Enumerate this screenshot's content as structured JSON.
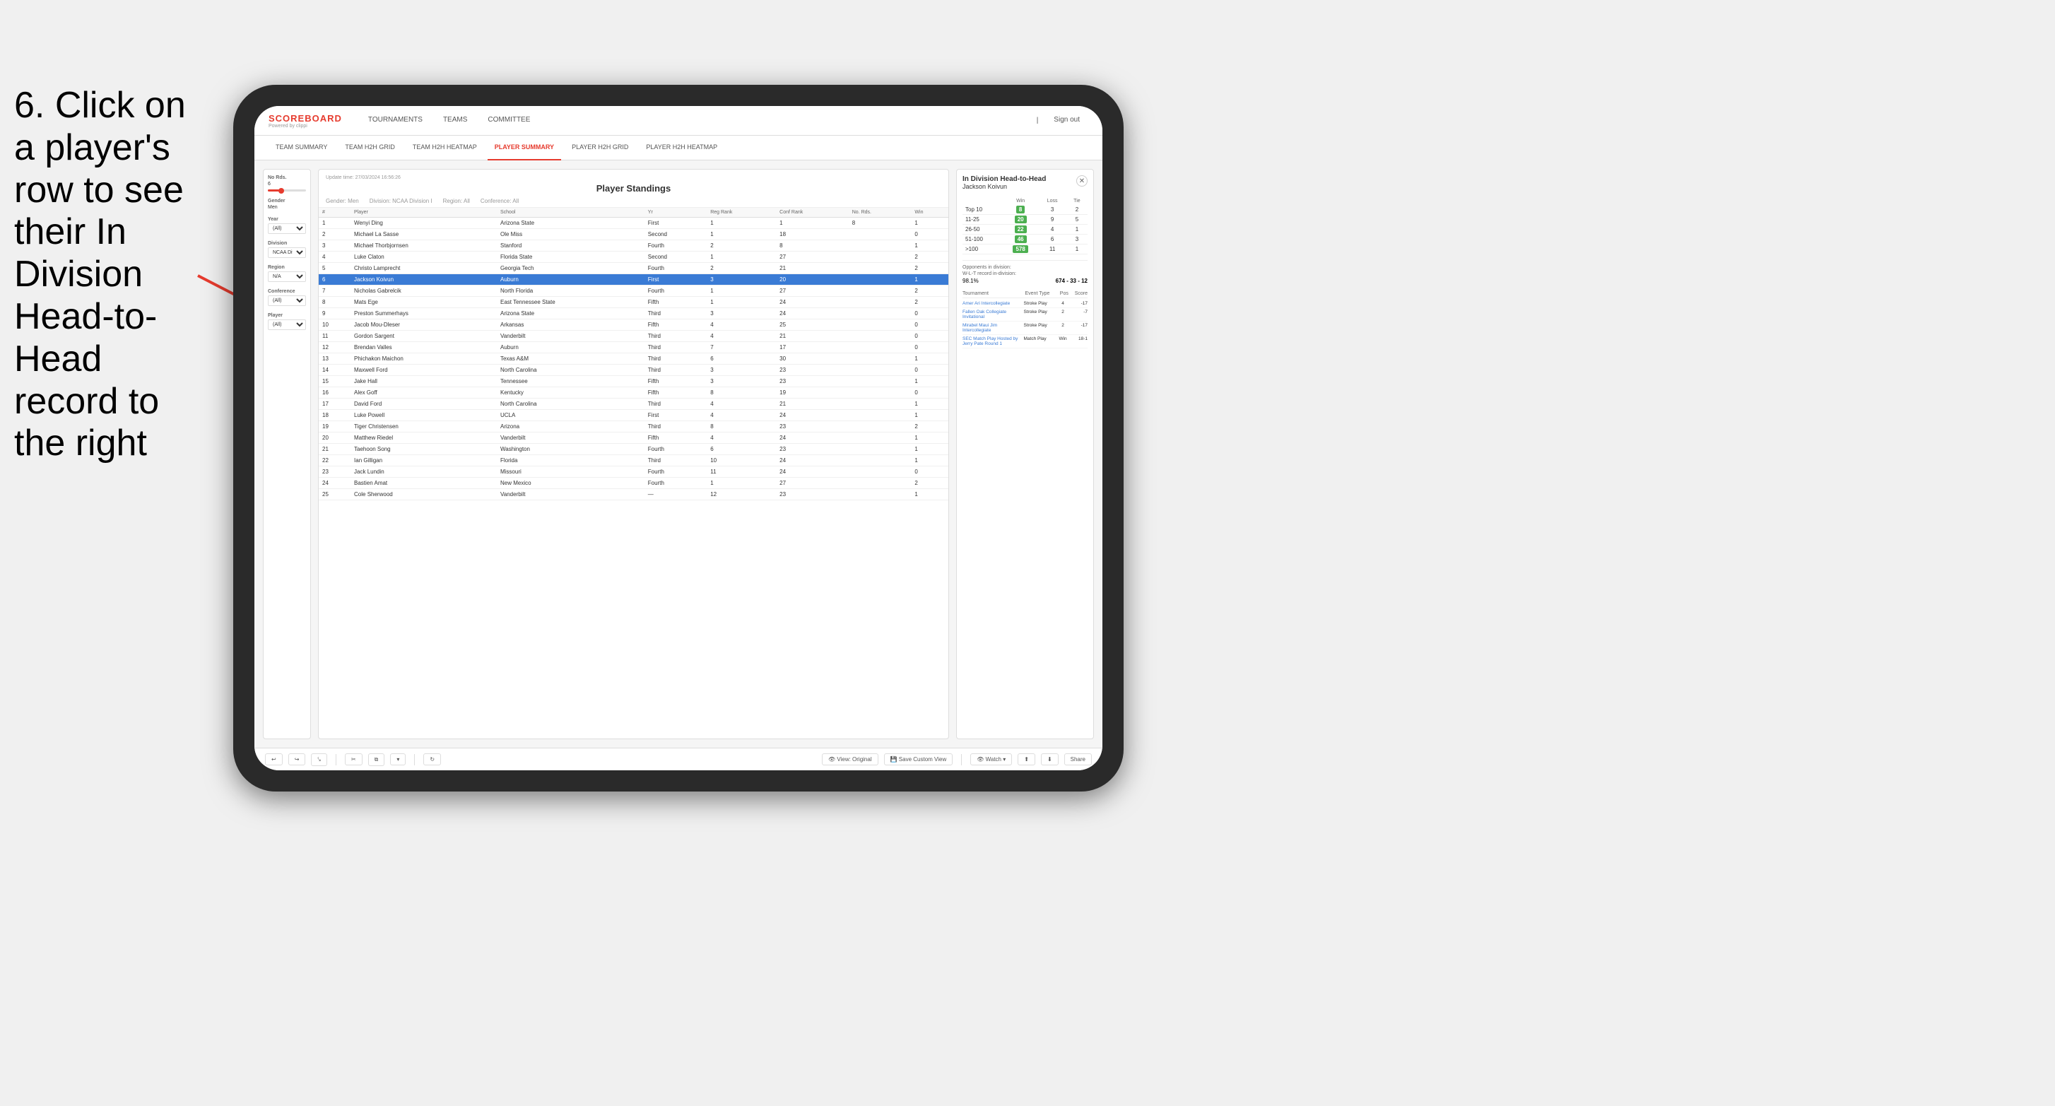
{
  "instruction": {
    "text": "6. Click on a player's row to see their In Division Head-to-Head record to the right"
  },
  "nav": {
    "logo_main": "SCOREBOARD",
    "logo_sub": "Powered by clippi",
    "items": [
      "TOURNAMENTS",
      "TEAMS",
      "COMMITTEE"
    ],
    "sign_out": "Sign out"
  },
  "sub_nav": {
    "items": [
      "TEAM SUMMARY",
      "TEAM H2H GRID",
      "TEAM H2H HEATMAP",
      "PLAYER SUMMARY",
      "PLAYER H2H GRID",
      "PLAYER H2H HEATMAP"
    ],
    "active": "PLAYER SUMMARY"
  },
  "filters": {
    "no_rds_label": "No Rds.",
    "no_rds_value": "6",
    "gender_label": "Gender",
    "gender_value": "Men",
    "year_label": "Year",
    "year_value": "(All)",
    "division_label": "Division",
    "division_value": "NCAA Division I",
    "region_label": "Region",
    "region_value": "N/A",
    "conference_label": "Conference",
    "conference_value": "(All)",
    "player_label": "Player",
    "player_value": "(All)"
  },
  "standings": {
    "update_time": "Update time: 27/03/2024 16:56:26",
    "title": "Player Standings",
    "gender_filter": "Gender: Men",
    "division_filter": "Division: NCAA Division I",
    "region_filter": "Region: All",
    "conference_filter": "Conference: All",
    "columns": [
      "#",
      "Player",
      "School",
      "Yr",
      "Reg Rank",
      "Conf Rank",
      "No. Rds.",
      "Win"
    ],
    "rows": [
      {
        "num": 1,
        "player": "Wenyi Ding",
        "school": "Arizona State",
        "year": "First",
        "reg_rank": 1,
        "conf_rank": 1,
        "no_rds": 8,
        "win": 1
      },
      {
        "num": 2,
        "player": "Michael La Sasse",
        "school": "Ole Miss",
        "year": "Second",
        "reg_rank": 1,
        "conf_rank": 18,
        "win": 0
      },
      {
        "num": 3,
        "player": "Michael Thorbjornsen",
        "school": "Stanford",
        "year": "Fourth",
        "reg_rank": 2,
        "conf_rank": 8,
        "win": 1
      },
      {
        "num": 4,
        "player": "Luke Claton",
        "school": "Florida State",
        "year": "Second",
        "reg_rank": 1,
        "conf_rank": 27,
        "win": 2
      },
      {
        "num": 5,
        "player": "Christo Lamprecht",
        "school": "Georgia Tech",
        "year": "Fourth",
        "reg_rank": 2,
        "conf_rank": 21,
        "win": 2
      },
      {
        "num": 6,
        "player": "Jackson Koivun",
        "school": "Auburn",
        "year": "First",
        "reg_rank": 3,
        "conf_rank": 20,
        "win": 1,
        "selected": true
      },
      {
        "num": 7,
        "player": "Nicholas Gabrelcik",
        "school": "North Florida",
        "year": "Fourth",
        "reg_rank": 1,
        "conf_rank": 27,
        "win": 2
      },
      {
        "num": 8,
        "player": "Mats Ege",
        "school": "East Tennessee State",
        "year": "Fifth",
        "reg_rank": 1,
        "conf_rank": 24,
        "win": 2
      },
      {
        "num": 9,
        "player": "Preston Summerhays",
        "school": "Arizona State",
        "year": "Third",
        "reg_rank": 3,
        "conf_rank": 24,
        "win": 0
      },
      {
        "num": 10,
        "player": "Jacob Mou-Dleser",
        "school": "Arkansas",
        "year": "Fifth",
        "reg_rank": 4,
        "conf_rank": 25,
        "win": 0
      },
      {
        "num": 11,
        "player": "Gordon Sargent",
        "school": "Vanderbilt",
        "year": "Third",
        "reg_rank": 4,
        "conf_rank": 21,
        "win": 0
      },
      {
        "num": 12,
        "player": "Brendan Valles",
        "school": "Auburn",
        "year": "Third",
        "reg_rank": 7,
        "conf_rank": 17,
        "win": 0
      },
      {
        "num": 13,
        "player": "Phichakon Maichon",
        "school": "Texas A&M",
        "year": "Third",
        "reg_rank": 6,
        "conf_rank": 30,
        "win": 1
      },
      {
        "num": 14,
        "player": "Maxwell Ford",
        "school": "North Carolina",
        "year": "Third",
        "reg_rank": 3,
        "conf_rank": 23,
        "win": 0
      },
      {
        "num": 15,
        "player": "Jake Hall",
        "school": "Tennessee",
        "year": "Fifth",
        "reg_rank": 3,
        "conf_rank": 23,
        "win": 1
      },
      {
        "num": 16,
        "player": "Alex Goff",
        "school": "Kentucky",
        "year": "Fifth",
        "reg_rank": 8,
        "conf_rank": 19,
        "win": 0
      },
      {
        "num": 17,
        "player": "David Ford",
        "school": "North Carolina",
        "year": "Third",
        "reg_rank": 4,
        "conf_rank": 21,
        "win": 1
      },
      {
        "num": 18,
        "player": "Luke Powell",
        "school": "UCLA",
        "year": "First",
        "reg_rank": 4,
        "conf_rank": 24,
        "win": 1
      },
      {
        "num": 19,
        "player": "Tiger Christensen",
        "school": "Arizona",
        "year": "Third",
        "reg_rank": 8,
        "conf_rank": 23,
        "win": 2
      },
      {
        "num": 20,
        "player": "Matthew Riedel",
        "school": "Vanderbilt",
        "year": "Fifth",
        "reg_rank": 4,
        "conf_rank": 24,
        "win": 1
      },
      {
        "num": 21,
        "player": "Taehoon Song",
        "school": "Washington",
        "year": "Fourth",
        "reg_rank": 6,
        "conf_rank": 23,
        "win": 1
      },
      {
        "num": 22,
        "player": "Ian Gilligan",
        "school": "Florida",
        "year": "Third",
        "reg_rank": 10,
        "conf_rank": 24,
        "win": 1
      },
      {
        "num": 23,
        "player": "Jack Lundin",
        "school": "Missouri",
        "year": "Fourth",
        "reg_rank": 11,
        "conf_rank": 24,
        "win": 0
      },
      {
        "num": 24,
        "player": "Bastien Amat",
        "school": "New Mexico",
        "year": "Fourth",
        "reg_rank": 1,
        "conf_rank": 27,
        "win": 2
      },
      {
        "num": 25,
        "player": "Cole Sherwood",
        "school": "Vanderbilt",
        "year": "—",
        "reg_rank": 12,
        "conf_rank": 23,
        "win": 1
      }
    ]
  },
  "h2h": {
    "title": "In Division Head-to-Head",
    "player": "Jackson Koivun",
    "table_headers": [
      "",
      "Win",
      "Loss",
      "Tie"
    ],
    "rows": [
      {
        "range": "Top 10",
        "win": 8,
        "loss": 3,
        "tie": 2
      },
      {
        "range": "11-25",
        "win": 20,
        "loss": 9,
        "tie": 5
      },
      {
        "range": "26-50",
        "win": 22,
        "loss": 4,
        "tie": 1
      },
      {
        "range": "51-100",
        "win": 46,
        "loss": 6,
        "tie": 3
      },
      {
        "range": ">100",
        "win": 578,
        "loss": 11,
        "tie": 1
      }
    ],
    "opponents_label": "Opponents in division:",
    "record_label": "W-L-T record in-division:",
    "opponents_pct": "98.1%",
    "record": "674 - 33 - 12",
    "tournament_columns": [
      "Tournament",
      "Event Type",
      "Pos",
      "Score"
    ],
    "tournaments": [
      {
        "name": "Amer Ari Intercollegiate",
        "type": "Stroke Play",
        "pos": 4,
        "score": "-17"
      },
      {
        "name": "Fallen Oak Collegiate Invitational",
        "type": "Stroke Play",
        "pos": 2,
        "score": "-7"
      },
      {
        "name": "Mirabel Maui Jim Intercollegiate",
        "type": "Stroke Play",
        "pos": 2,
        "score": "-17"
      },
      {
        "name": "SEC Match Play Hosted by Jerry Pate Round 1",
        "type": "Match Play",
        "pos": "Win",
        "score": "18-1"
      }
    ]
  },
  "toolbar": {
    "buttons": [
      "↩",
      "↪",
      "⤥",
      "✂",
      "⧉",
      "▾",
      "↻",
      "👁 View: Original",
      "💾 Save Custom View",
      "👁 Watch ▾",
      "⬆",
      "⬇",
      "Share"
    ]
  }
}
